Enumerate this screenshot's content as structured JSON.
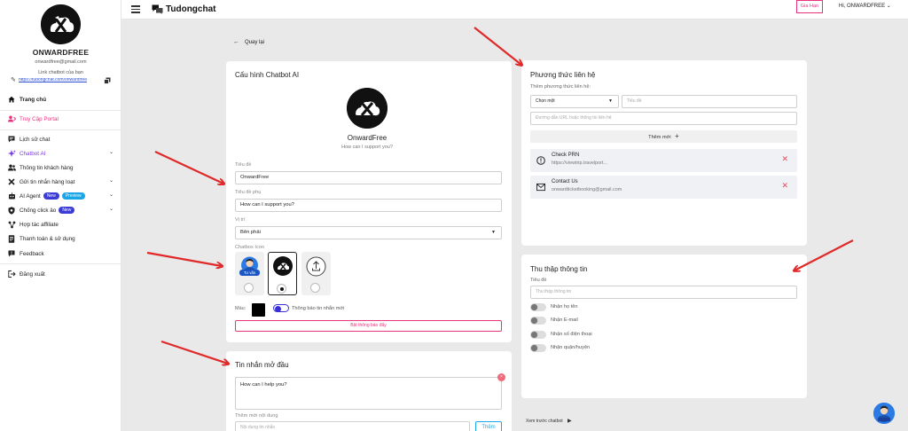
{
  "sidebar": {
    "user_name": "ONWARDFREE",
    "user_email": "onwardfree@gmail.com",
    "link_label": "Link chatbot của bạn",
    "link_url": "https://tudongchat.com/onwardfree",
    "items": [
      {
        "label": "Trang chủ",
        "icon": "home-icon"
      },
      {
        "label": "Truy Cập Portal",
        "icon": "portal-icon"
      },
      {
        "label": "Lịch sử chat",
        "icon": "chat-history-icon"
      },
      {
        "label": "Chatbot AI",
        "icon": "sparkle-icon"
      },
      {
        "label": "Thông tin khách hàng",
        "icon": "customers-icon"
      },
      {
        "label": "Gửi tin nhắn hàng loạt",
        "icon": "broadcast-icon"
      },
      {
        "label": "AI Agent",
        "icon": "ai-agent-icon",
        "badges": [
          "New",
          "Preview"
        ]
      },
      {
        "label": "Chống click ảo",
        "icon": "shield-icon",
        "badges": [
          "New"
        ]
      },
      {
        "label": "Hợp tác affiliate",
        "icon": "affiliate-icon"
      },
      {
        "label": "Thanh toán & sử dụng",
        "icon": "billing-icon"
      },
      {
        "label": "Feedback",
        "icon": "feedback-icon"
      },
      {
        "label": "Đăng xuất",
        "icon": "logout-icon"
      }
    ]
  },
  "topbar": {
    "brand": "Tudongchat",
    "renew_button": "Gia Hạn",
    "user_greeting": "Hi, ONWARDFREE"
  },
  "back_link": "Quay lại",
  "config_card": {
    "title": "Cấu hình Chatbot AI",
    "preview_name": "OnwardFree",
    "preview_subtitle": "How can I support you?",
    "title_label": "Tiêu đề",
    "title_value": "OnwardFree",
    "subtitle_label": "Tiêu đề phụ",
    "subtitle_value": "How can I support you?",
    "position_label": "Vị trí",
    "position_value": "Bên phải",
    "icon_label": "Chatbox Icon",
    "icon_badge": "Tư vấn",
    "color_label": "Màu:",
    "color_value": "#000000",
    "notify_label": "Thông báo tin nhắn mới",
    "notify_on": true,
    "enable_notify_button": "Bật thông báo đẩy"
  },
  "welcome_card": {
    "title": "Tin nhắn mở đầu",
    "message": "How can I help you?",
    "add_label": "Thêm mới nội dung",
    "add_placeholder": "Nội dung tin nhắn",
    "add_button": "Thêm"
  },
  "contact_card": {
    "title": "Phương thức liên hệ",
    "add_label": "Thêm phương thức liên hệ:",
    "select_placeholder": "Chọn một",
    "title_placeholder": "Tiêu đề",
    "url_placeholder": "Đường dẫn URL hoặc thông tin liên hệ",
    "add_button": "Thêm mới",
    "items": [
      {
        "title": "Check PRN",
        "value": "https://viewtrip.travelport...",
        "icon": "info-circle-icon"
      },
      {
        "title": "Contact Us",
        "value": "onwardticketbooking@gmail.com",
        "icon": "mail-icon"
      }
    ]
  },
  "collect_card": {
    "title": "Thu thập thông tin",
    "title_label": "Tiêu đề",
    "title_placeholder": "Thu thập thông tin",
    "toggles": [
      {
        "label": "Nhận họ tên",
        "on": false
      },
      {
        "label": "Nhận E-mail",
        "on": false
      },
      {
        "label": "Nhận số điện thoại",
        "on": false
      },
      {
        "label": "Nhận quận/huyện",
        "on": false
      }
    ]
  },
  "preview_label": "Xem trước chatbot",
  "colors": {
    "accent_pink": "#e8347f",
    "accent_purple": "#7a3ce6",
    "accent_blue": "#1aa7e8",
    "annotation_red": "#e02a2a"
  }
}
